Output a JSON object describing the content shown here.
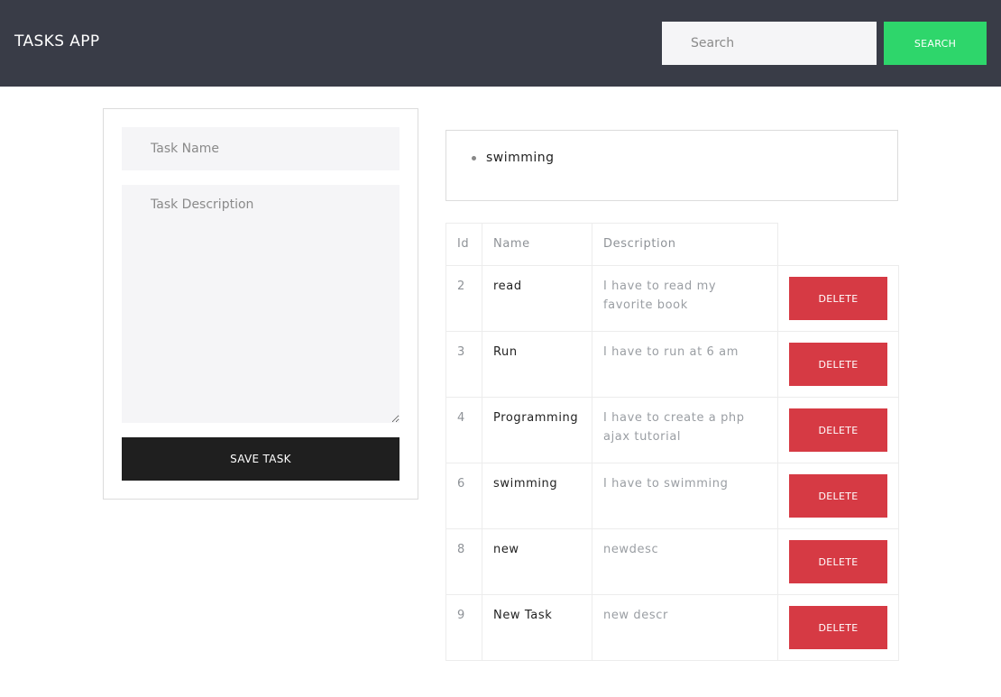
{
  "header": {
    "brand": "TASKS APP",
    "search_placeholder": "Search",
    "search_button": "SEARCH"
  },
  "form": {
    "name_placeholder": "Task Name",
    "description_placeholder": "Task Description",
    "save_button": "SAVE TASK"
  },
  "search_results": [
    "swimming"
  ],
  "table": {
    "headers": [
      "Id",
      "Name",
      "Description"
    ],
    "rows": [
      {
        "id": "2",
        "name": "read",
        "description": "I have to read my favorite book",
        "action": "DELETE"
      },
      {
        "id": "3",
        "name": "Run",
        "description": "I have to run at 6 am",
        "action": "DELETE"
      },
      {
        "id": "4",
        "name": "Programming",
        "description": "I have to create a php ajax tutorial",
        "action": "DELETE"
      },
      {
        "id": "6",
        "name": "swimming",
        "description": "I have to swimming",
        "action": "DELETE"
      },
      {
        "id": "8",
        "name": "new",
        "description": "newdesc",
        "action": "DELETE"
      },
      {
        "id": "9",
        "name": "New Task",
        "description": "new descr",
        "action": "DELETE"
      }
    ]
  },
  "colors": {
    "navbar": "#393c47",
    "search_button": "#2ed66b",
    "save_button": "#1f1f1f",
    "delete_button": "#d63a44"
  }
}
